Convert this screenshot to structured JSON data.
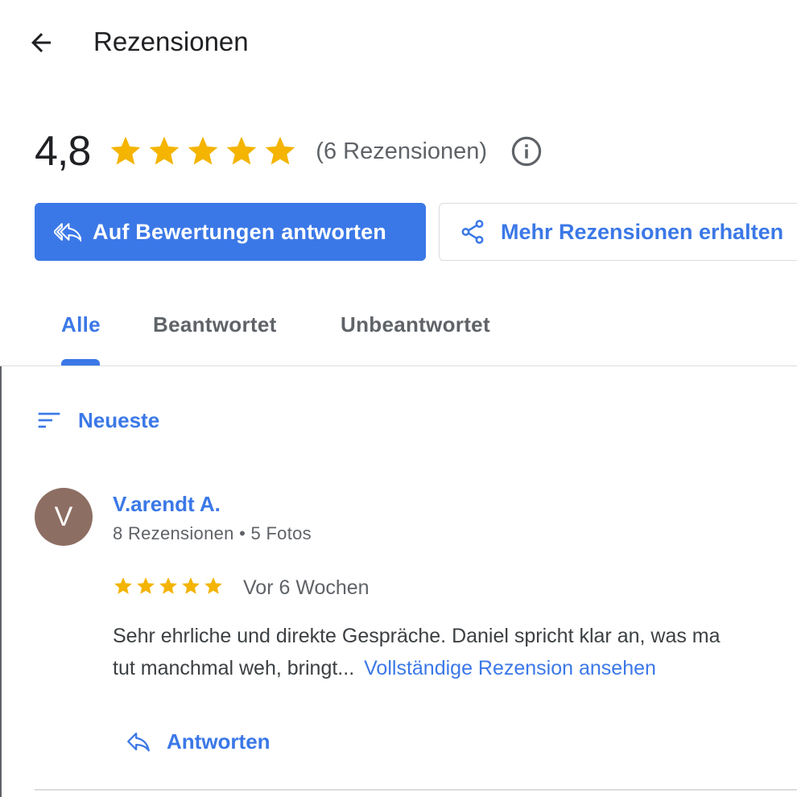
{
  "header": {
    "title": "Rezensionen",
    "back_icon": "arrow-back-icon"
  },
  "summary": {
    "rating": "4,8",
    "stars": 5,
    "star_color": "#F4B400",
    "count_text": "(6 Rezensionen)",
    "info_icon": "info-icon"
  },
  "actions": {
    "reply_label": "Auf Bewertungen antworten",
    "reply_icon": "reply-all-icon",
    "more_label": "Mehr Rezensionen erhalten",
    "more_icon": "share-icon"
  },
  "tabs": [
    {
      "label": "Alle",
      "active": true
    },
    {
      "label": "Beantwortet",
      "active": false
    },
    {
      "label": "Unbeantwortet",
      "active": false
    }
  ],
  "sort": {
    "label": "Neueste",
    "icon": "sort-icon"
  },
  "review": {
    "avatar_letter": "V",
    "avatar_color": "#8D6E63",
    "name": "V.arendt A.",
    "meta": "8 Rezensionen • 5 Fotos",
    "stars": 5,
    "date": "Vor 6 Wochen",
    "text_line1": "Sehr ehrliche und direkte Gespräche. Daniel spricht klar an, was ma",
    "text_line2": "tut manchmal weh, bringt...",
    "more_link": "Vollständige Rezension ansehen",
    "reply_label": "Antworten",
    "reply_icon": "reply-icon"
  },
  "colors": {
    "accent": "#3B78E7",
    "text_primary": "#202124",
    "text_secondary": "#5F6368",
    "divider": "#DADCE0"
  }
}
